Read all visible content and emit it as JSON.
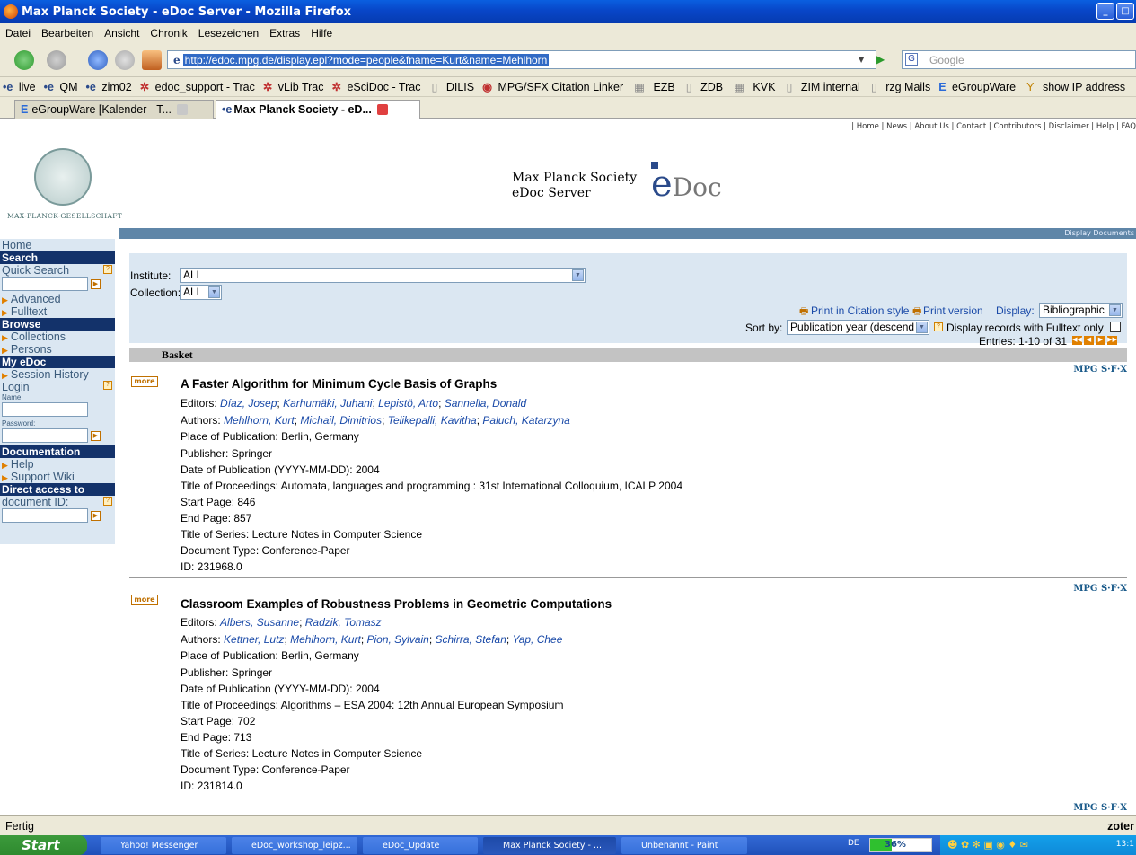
{
  "window": {
    "title": "Max Planck Society - eDoc Server - Mozilla Firefox"
  },
  "menu": [
    "Datei",
    "Bearbeiten",
    "Ansicht",
    "Chronik",
    "Lesezeichen",
    "Extras",
    "Hilfe"
  ],
  "address": {
    "url": "http://edoc.mpg.de/display.epl?mode=people&fname=Kurt&name=Mehlhorn",
    "search_placeholder": "Google"
  },
  "bookmarks": [
    "live",
    "QM",
    "zim02",
    "edoc_support - Trac",
    "vLib Trac",
    "eSciDoc - Trac",
    "DILIS",
    "MPG/SFX Citation Linker",
    "EZB",
    "ZDB",
    "KVK",
    "ZIM internal",
    "rzg Mails",
    "eGroupWare",
    "show IP address"
  ],
  "tabs": [
    "eGroupWare [Kalender - T...",
    "Max Planck Society - eD..."
  ],
  "page": {
    "top_links": "| Home | News | About Us | Contact | Contributors | Disclaimer | Help | FAQ",
    "logo_text": "MAX-PLANCK-GESELLSCHAFT",
    "brand_line1": "Max Planck Society",
    "brand_line2": "eDoc Server",
    "edoc_e": "e",
    "edoc_doc": "Doc",
    "bar_link": "Display Documents",
    "sidebar": {
      "home": "Home",
      "search_hd": "Search",
      "quick_search": "Quick Search",
      "advanced": "Advanced",
      "fulltext": "Fulltext",
      "browse_hd": "Browse",
      "collections": "Collections",
      "persons": "Persons",
      "myedoc_hd": "My eDoc",
      "session_history": "Session History",
      "login": "Login",
      "name_lbl": "Name:",
      "password_lbl": "Password:",
      "doc_hd": "Documentation",
      "help": "Help",
      "support_wiki": "Support Wiki",
      "direct_hd": "Direct access to",
      "document_id": "document ID:"
    },
    "filter": {
      "institute_lbl": "Institute:",
      "institute_val": "ALL",
      "collection_lbl": "Collection:",
      "collection_val": "ALL",
      "print_citation": "Print in Citation style",
      "print_version": "Print version",
      "display_lbl": "Display:",
      "display_val": "Bibliographic",
      "sortby_lbl": "Sort by:",
      "sortby_val": "Publication year (descend",
      "fulltext_only": "Display records with Fulltext only",
      "entries": "Entries: 1-10 of 31"
    },
    "basket": "Basket",
    "more_label": "more",
    "sfx_label": "MPG S·F·X",
    "records": [
      {
        "title": "A Faster Algorithm for Minimum Cycle Basis of Graphs",
        "editors_lbl": "Editors:",
        "editors": [
          "Díaz, Josep",
          "Karhumäki, Juhani",
          "Lepistö, Arto",
          "Sannella, Donald"
        ],
        "authors_lbl": "Authors:",
        "authors": [
          "Mehlhorn, Kurt",
          "Michail, Dimitrios",
          "Telikepalli, Kavitha",
          "Paluch, Katarzyna"
        ],
        "lines": [
          "Place of Publication: Berlin, Germany",
          "Publisher: Springer",
          "Date of Publication (YYYY-MM-DD): 2004",
          "Title of Proceedings: Automata, languages and programming : 31st International Colloquium, ICALP 2004",
          "Start Page: 846",
          "End Page: 857",
          "Title of Series: Lecture Notes in Computer Science",
          "Document Type: Conference-Paper",
          "ID: 231968.0"
        ]
      },
      {
        "title": "Classroom Examples of Robustness Problems in Geometric Computations",
        "editors_lbl": "Editors:",
        "editors": [
          "Albers, Susanne",
          "Radzik, Tomasz"
        ],
        "authors_lbl": "Authors:",
        "authors": [
          "Kettner, Lutz",
          "Mehlhorn, Kurt",
          "Pion, Sylvain",
          "Schirra, Stefan",
          "Yap, Chee"
        ],
        "lines": [
          "Place of Publication: Berlin, Germany",
          "Publisher: Springer",
          "Date of Publication (YYYY-MM-DD): 2004",
          "Title of Proceedings: Algorithms – ESA 2004: 12th Annual European Symposium",
          "Start Page: 702",
          "End Page: 713",
          "Title of Series: Lecture Notes in Computer Science",
          "Document Type: Conference-Paper",
          "ID: 231814.0"
        ]
      }
    ]
  },
  "status": {
    "text": "Fertig",
    "right": "zoter"
  },
  "taskbar": {
    "start": "Start",
    "buttons": [
      "Yahoo! Messenger",
      "eDoc_workshop_leipz...",
      "eDoc_Update",
      "Max Planck Society - ...",
      "Unbenannt - Paint"
    ],
    "lang": "DE",
    "battery": "36%",
    "clock": "13:1"
  },
  "colors": {
    "accent": "#13326a",
    "sidebar_bg": "#dbe7f2",
    "link": "#1a4aa8",
    "more": "#c07000"
  }
}
